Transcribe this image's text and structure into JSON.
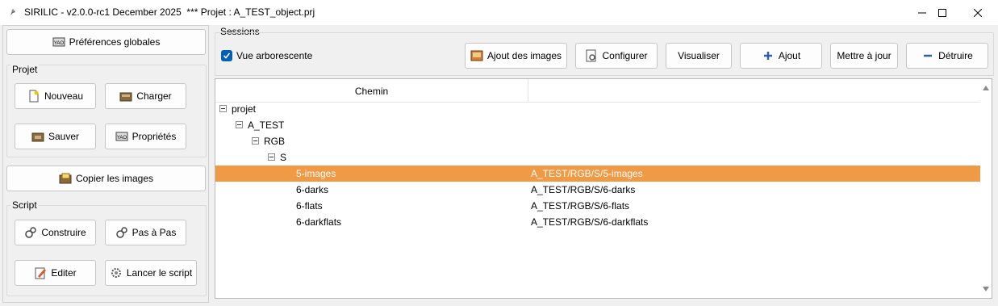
{
  "window": {
    "title": "SIRILIC - v2.0.0-rc1 December 2025  *** Projet : A_TEST_object.prj"
  },
  "left": {
    "prefs_label": "Préférences globales",
    "projet_group": "Projet",
    "nouveau_label": "Nouveau",
    "charger_label": "Charger",
    "sauver_label": "Sauver",
    "proprietes_label": "Propriétés",
    "copier_label": "Copier les images",
    "script_group": "Script",
    "construire_label": "Construire",
    "pas_a_pas_label": "Pas à Pas",
    "editer_label": "Editer",
    "lancer_label": "Lancer le script"
  },
  "sessions": {
    "group_label": "Sessions",
    "tree_view_label": "Vue arborescente",
    "tree_view_checked": true,
    "ajout_images_label": "Ajout des images",
    "configurer_label": "Configurer",
    "visualiser_label": "Visualiser",
    "ajout_label": "Ajout",
    "mettre_a_jour_label": "Mettre à jour",
    "detruire_label": "Détruire"
  },
  "tree": {
    "column_header": "Chemin",
    "rows": [
      {
        "name": "projet",
        "path": ""
      },
      {
        "name": "A_TEST",
        "path": ""
      },
      {
        "name": "RGB",
        "path": ""
      },
      {
        "name": "S",
        "path": ""
      },
      {
        "name": "5-images",
        "path": "A_TEST/RGB/S/5-images",
        "selected": true
      },
      {
        "name": "6-darks",
        "path": "A_TEST/RGB/S/6-darks"
      },
      {
        "name": "6-flats",
        "path": "A_TEST/RGB/S/6-flats"
      },
      {
        "name": "6-darkflats",
        "path": "A_TEST/RGB/S/6-darkflats"
      }
    ]
  },
  "colors": {
    "selection": "#f09a46",
    "checkbox": "#005fb8"
  }
}
